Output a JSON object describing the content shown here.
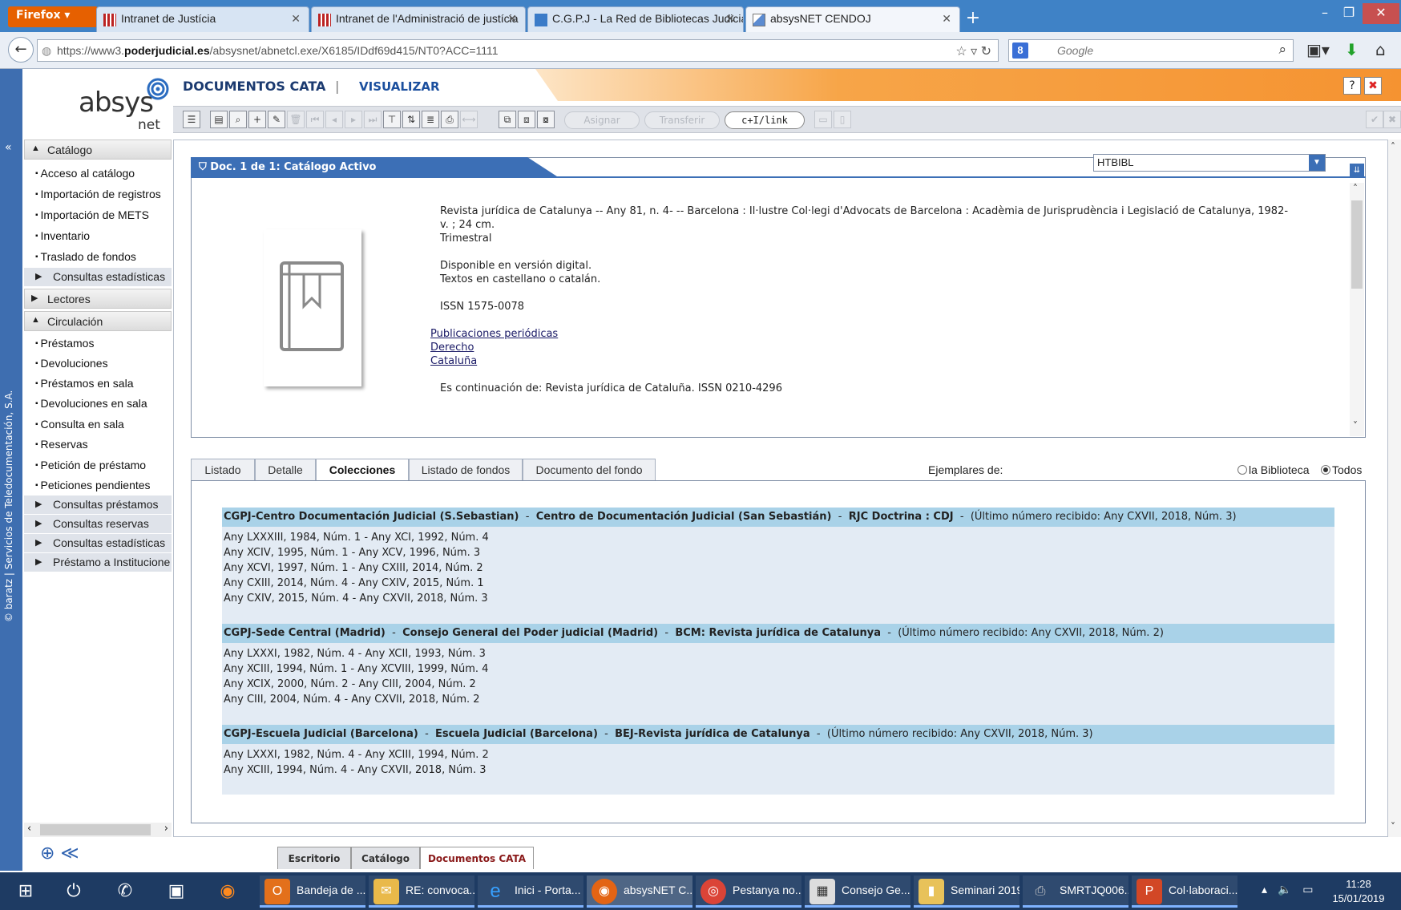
{
  "browser": {
    "menu_label": "Firefox",
    "tabs": [
      {
        "title": "Intranet de Justícia"
      },
      {
        "title": "Intranet de l'Administració de justícia"
      },
      {
        "title": "C.G.P.J - La Red de Bibliotecas Judicia..."
      },
      {
        "title": "absysNET CENDOJ"
      }
    ],
    "url_prefix": "https://www3.",
    "url_domain": "poderjudicial.es",
    "url_path": "/absysnet/abnetcl.exe/X6185/IDdf69d415/NT0?ACC=1111",
    "search_placeholder": "Google",
    "search_engine_icon": "google-icon"
  },
  "app": {
    "logo_main": "absys",
    "logo_sub": "net",
    "module_title": "DOCUMENTOS CATA",
    "module_separator": "|",
    "module_action": "VISUALIZAR",
    "help_label": "?",
    "close_label": "✖",
    "vendor_text": "© baratz | Servicios de Teledocumentación, S.A.",
    "toolbar": {
      "assign_label": "Asignar",
      "transfer_label": "Transferir",
      "link_label": "c+I/link"
    }
  },
  "sidebar": {
    "sections": [
      {
        "label": "Catálogo",
        "items": [
          "Acceso al catálogo",
          "Importación de registros",
          "Importación de METS",
          "Inventario",
          "Traslado de fondos"
        ],
        "subs": [
          "Consultas estadísticas"
        ]
      },
      {
        "label": "Lectores"
      },
      {
        "label": "Circulación",
        "items": [
          "Préstamos",
          "Devoluciones",
          "Préstamos en sala",
          "Devoluciones en sala",
          "Consulta en sala",
          "Reservas",
          "Petición de préstamo",
          "Peticiones pendientes"
        ],
        "subs": [
          "Consultas préstamos",
          "Consultas reservas",
          "Consultas estadísticas",
          "Préstamo a Institucione"
        ]
      }
    ]
  },
  "document": {
    "tab_label": "Doc. 1 de 1: Catálogo Activo",
    "format_value": "HTBIBL",
    "record_lines": [
      "Revista jurídica de Catalunya  -- Any 81, n. 4-  --  Barcelona : Il·lustre Col·legi d'Advocats de Barcelona : Acadèmia de Jurisprudència i Legislació de Catalunya, 1982-",
      "v. ; 24 cm.",
      "Trimestral",
      "Disponible en versión digital.",
      "Textos en castellano o catalán.",
      "ISSN 1575-0078"
    ],
    "subjects": [
      "Publicaciones periódicas",
      "Derecho",
      "Cataluña"
    ],
    "continuation": "Es continuación de: Revista jurídica de Cataluña. ISSN 0210-4296"
  },
  "collections": {
    "tabs": [
      "Listado",
      "Detalle",
      "Colecciones",
      "Listado de fondos",
      "Documento del fondo"
    ],
    "active_tab": "Colecciones",
    "ejemplares_label": "Ejemplares de:",
    "radio_library": "la Biblioteca",
    "radio_all": "Todos",
    "libraries": [
      {
        "org": "CGPJ-Centro Documentación Judicial (S.Sebastian)",
        "center": "Centro de Documentación Judicial (San Sebastián)",
        "signature": "RJC Doctrina : CDJ",
        "last": "(Último número recibido: Any CXVII, 2018, Núm. 3)",
        "holdings": [
          "Any LXXXIII, 1984, Núm. 1 - Any XCI, 1992, Núm. 4",
          "Any XCIV, 1995, Núm. 1 - Any XCV, 1996, Núm. 3",
          "Any XCVI, 1997, Núm. 1 - Any CXIII, 2014, Núm. 2",
          "Any CXIII, 2014, Núm. 4 - Any CXIV, 2015, Núm. 1",
          "Any CXIV, 2015, Núm. 4 - Any CXVII, 2018, Núm. 3"
        ]
      },
      {
        "org": "CGPJ-Sede Central (Madrid)",
        "center": "Consejo General del Poder judicial (Madrid)",
        "signature": "BCM: Revista jurídica de Catalunya",
        "last": "(Último número recibido: Any CXVII, 2018, Núm. 2)",
        "holdings": [
          "Any LXXXI, 1982, Núm. 4 - Any XCII, 1993, Núm. 3",
          "Any XCIII, 1994, Núm. 1 - Any XCVIII, 1999, Núm. 4",
          "Any XCIX, 2000, Núm. 2 - Any CIII, 2004, Núm. 2",
          "Any CIII, 2004, Núm. 4 - Any CXVII, 2018, Núm. 2"
        ]
      },
      {
        "org": "CGPJ-Escuela Judicial (Barcelona)",
        "center": "Escuela Judicial (Barcelona)",
        "signature": "BEJ-Revista jurídica de Catalunya",
        "last": "(Último número recibido: Any CXVII, 2018, Núm. 3)",
        "holdings": [
          "Any LXXXI, 1982, Núm. 4 - Any XCIII, 1994, Núm. 2",
          "Any XCIII, 1994, Núm. 4 - Any CXVII, 2018, Núm. 3"
        ]
      }
    ]
  },
  "app_tabs": [
    "Escritorio",
    "Catálogo",
    "Documentos CATA"
  ],
  "app_tab_active": "Documentos CATA",
  "taskbar": {
    "items": [
      "Bandeja de ...",
      "RE: convoca...",
      "Inici - Porta...",
      "absysNET C...",
      "Pestanya no...",
      "Consejo Ge...",
      "Seminari 2019",
      "SMRTJQ006...",
      "Col·laboraci..."
    ],
    "time": "11:28",
    "date": "15/01/2019"
  },
  "colors": {
    "accent_blue": "#3c6fb6",
    "header_orange": "#f59331",
    "library_header": "#a9d2e8",
    "taskbar": "#1e3b63"
  }
}
